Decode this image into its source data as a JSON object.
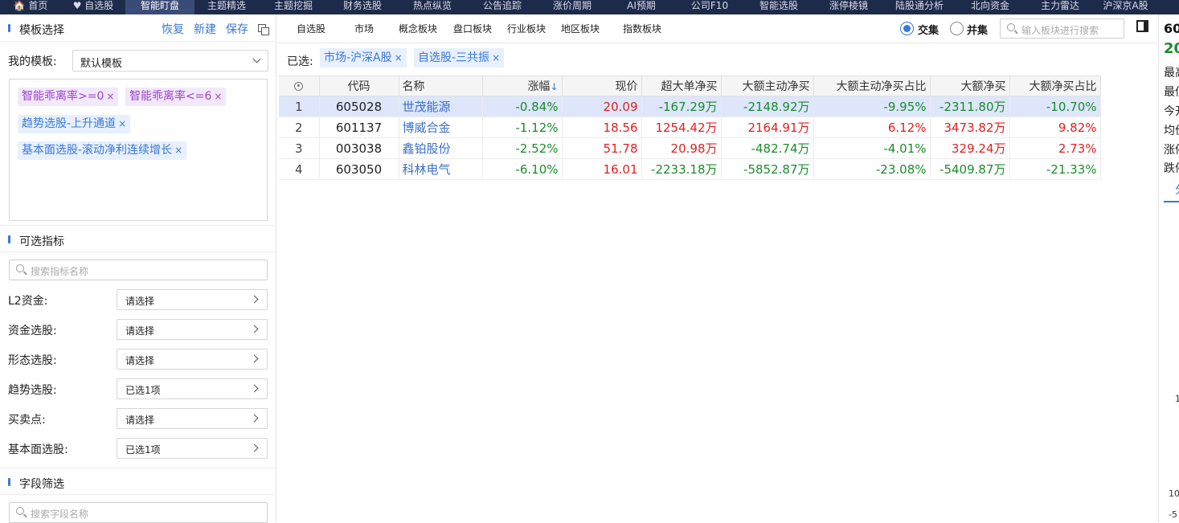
{
  "topnav": [
    {
      "label": "🏠 首页",
      "active": false
    },
    {
      "label": "♥ 自选股",
      "active": false
    },
    {
      "label": "智能盯盘",
      "active": true
    },
    {
      "label": "主题精选",
      "active": false
    },
    {
      "label": "主题挖掘",
      "active": false
    },
    {
      "label": "财务选股",
      "active": false
    },
    {
      "label": "热点纵览",
      "active": false
    },
    {
      "label": "公告追踪",
      "active": false
    },
    {
      "label": "涨价周期",
      "active": false
    },
    {
      "label": "AI预期",
      "active": false
    },
    {
      "label": "公司F10",
      "active": false
    },
    {
      "label": "智能选股",
      "active": false
    },
    {
      "label": "涨停棱镜",
      "active": false
    },
    {
      "label": "陆股通分析",
      "active": false
    },
    {
      "label": "北向资金",
      "active": false
    },
    {
      "label": "主力雷达",
      "active": false
    },
    {
      "label": "沪深京A股",
      "active": false
    }
  ],
  "template_section": {
    "title": "模板选择",
    "restore": "恢复",
    "new": "新建",
    "save": "保存",
    "my_template_label": "我的模板:",
    "my_template_value": "默认模板",
    "tags": [
      {
        "text": "智能乖离率>=0",
        "color": "purple"
      },
      {
        "text": "智能乖离率<=6",
        "color": "purple"
      },
      {
        "text": "趋势选股-上升通道",
        "color": "blue"
      },
      {
        "text": "基本面选股-滚动净利连续增长",
        "color": "blue"
      }
    ],
    "remove_glyph": "×"
  },
  "indicator_section": {
    "title": "可选指标",
    "search_placeholder": "搜索指标名称",
    "filters": [
      {
        "label": "L2资金:",
        "value": "请选择"
      },
      {
        "label": "资金选股:",
        "value": "请选择"
      },
      {
        "label": "形态选股:",
        "value": "请选择"
      },
      {
        "label": "趋势选股:",
        "value": "已选1项"
      },
      {
        "label": "买卖点:",
        "value": "请选择"
      },
      {
        "label": "基本面选股:",
        "value": "已选1项"
      }
    ]
  },
  "field_section": {
    "title": "字段筛选",
    "search_placeholder": "搜索字段名称"
  },
  "tabbar": {
    "tabs": [
      "自选股",
      "市场",
      "概念板块",
      "盘口板块",
      "行业板块",
      "地区板块",
      "指数板块"
    ],
    "radio_intersect": "交集",
    "radio_union": "并集",
    "search_placeholder": "输入板块进行搜索"
  },
  "selected": {
    "label": "已选:",
    "tags": [
      "市场-沪深A股",
      "自选股-三共振"
    ]
  },
  "table": {
    "headers": [
      "代码",
      "名称",
      "涨幅",
      "现价",
      "超大单净买",
      "大额主动净买",
      "大额主动净买占比",
      "大额净买",
      "大额净买占比"
    ],
    "sort_arrow": "↓",
    "rows": [
      {
        "idx": "1",
        "code": "605028",
        "name": "世茂能源",
        "change": "-0.84%",
        "price": "20.09",
        "super_net": "-167.29万",
        "active_net": "-2148.92万",
        "active_ratio": "-9.95%",
        "large_net": "-2311.80万",
        "large_ratio": "-10.70%",
        "selected": true
      },
      {
        "idx": "2",
        "code": "601137",
        "name": "博威合金",
        "change": "-1.12%",
        "price": "18.56",
        "super_net": "1254.42万",
        "active_net": "2164.91万",
        "active_ratio": "6.12%",
        "large_net": "3473.82万",
        "large_ratio": "9.82%",
        "selected": false
      },
      {
        "idx": "3",
        "code": "003038",
        "name": "鑫铂股份",
        "change": "-2.52%",
        "price": "51.78",
        "super_net": "20.98万",
        "active_net": "-482.74万",
        "active_ratio": "-4.01%",
        "large_net": "329.24万",
        "large_ratio": "2.73%",
        "selected": false
      },
      {
        "idx": "4",
        "code": "603050",
        "name": "科林电气",
        "change": "-6.10%",
        "price": "16.01",
        "super_net": "-2233.18万",
        "active_net": "-5852.87万",
        "active_ratio": "-23.08%",
        "large_net": "-5409.87万",
        "large_ratio": "-21.33%",
        "selected": false
      }
    ]
  },
  "right_panel": {
    "code_partial": "60",
    "price_partial": "20",
    "labels": [
      "最高",
      "最低",
      "今开",
      "均价",
      "涨停",
      "跌停"
    ],
    "tab_partial": "分",
    "tick_1": "1",
    "tick_10": "10",
    "tick_neg": "-5"
  },
  "colors": {
    "accent": "#3a78d6",
    "up": "#e02020",
    "down": "#1a8c2b",
    "nav_bg": "#1e2a4a",
    "selected_row": "#dde6fb"
  }
}
